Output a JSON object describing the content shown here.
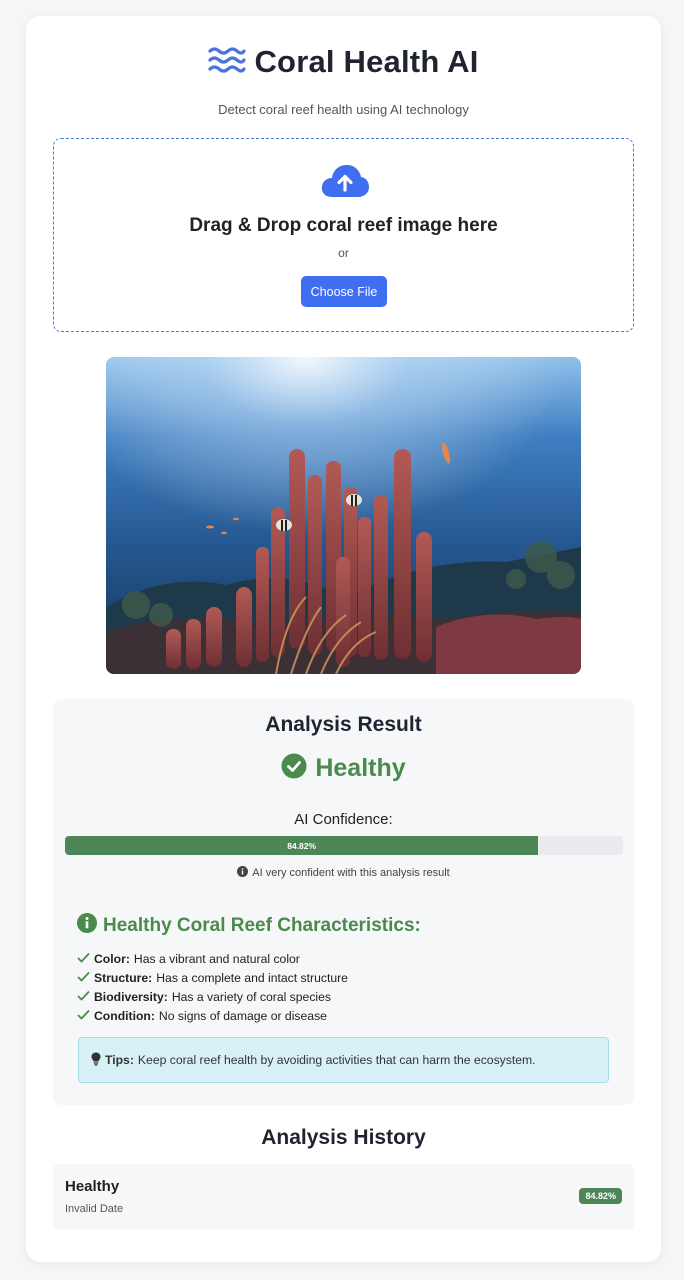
{
  "app": {
    "title": "Coral Health AI",
    "subtitle": "Detect coral reef health using AI technology",
    "brand_color": "#3f6ef1"
  },
  "upload": {
    "title": "Drag & Drop coral reef image here",
    "or_text": "or",
    "button_label": "Choose File",
    "icon": "cloud-upload-icon"
  },
  "preview": {
    "icon": "coral-reef-photo"
  },
  "analysis": {
    "title": "Analysis Result",
    "status": "Healthy",
    "status_color": "#4a8a4c",
    "confidence_label": "AI Confidence:",
    "confidence_value": 84.82,
    "confidence_text": "84.82%",
    "confidence_note": "AI very confident with this analysis result",
    "characteristics_title": "Healthy Coral Reef Characteristics:",
    "characteristics": [
      {
        "label": "Color:",
        "text": "Has a vibrant and natural color"
      },
      {
        "label": "Structure:",
        "text": "Has a complete and intact structure"
      },
      {
        "label": "Biodiversity:",
        "text": "Has a variety of coral species"
      },
      {
        "label": "Condition:",
        "text": "No signs of damage or disease"
      }
    ],
    "tips_label": "Tips:",
    "tips_text": "Keep coral reef health by avoiding activities that can harm the ecosystem."
  },
  "history": {
    "title": "Analysis History",
    "items": [
      {
        "status": "Healthy",
        "date": "Invalid Date",
        "confidence": "84.82%"
      }
    ]
  }
}
